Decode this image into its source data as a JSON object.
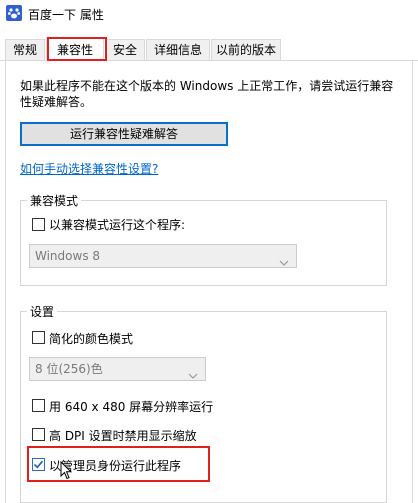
{
  "window": {
    "title": "百度一下 属性",
    "icon": "paw-icon"
  },
  "tabs": [
    {
      "label": "常规"
    },
    {
      "label": "兼容性"
    },
    {
      "label": "安全"
    },
    {
      "label": "详细信息"
    },
    {
      "label": "以前的版本"
    }
  ],
  "active_tab": "兼容性",
  "intro_text": "如果此程序不能在这个版本的 Windows 上正常工作，请尝试运行兼容性疑难解答。",
  "troubleshoot_button": "运行兼容性疑难解答",
  "manual_link": "如何手动选择兼容性设置?",
  "compat_mode": {
    "group_label": "兼容模式",
    "checkbox_label": "以兼容模式运行这个程序:",
    "checked": false,
    "dropdown_value": "Windows 8"
  },
  "settings": {
    "group_label": "设置",
    "reduced_color": {
      "label": "简化的颜色模式",
      "checked": false
    },
    "color_dropdown_value": "8 位(256)色",
    "res_640": {
      "label": "用 640 x 480 屏幕分辨率运行",
      "checked": false
    },
    "high_dpi": {
      "label": "高 DPI 设置时禁用显示缩放",
      "checked": false
    },
    "run_as_admin": {
      "label": "以管理员身份运行此程序",
      "checked": true
    }
  },
  "colors": {
    "highlight": "#e02020",
    "link": "#0066cc",
    "accent": "#0a70c6"
  }
}
